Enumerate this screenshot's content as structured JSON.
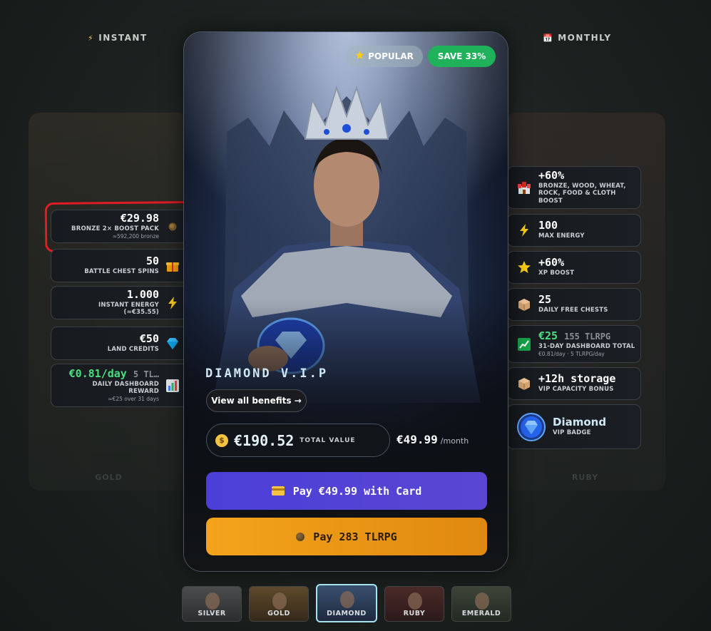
{
  "tabs": {
    "instant": {
      "icon": "⚡",
      "label": "INSTANT"
    },
    "monthly": {
      "icon": "📅",
      "label": "MONTHLY"
    }
  },
  "background_cards": {
    "left_name": "GOLD",
    "right_name": "RUBY"
  },
  "left_benefits": [
    {
      "main": "€29.98",
      "sub": "BRONZE 2× BOOST PACK",
      "note": "≈592,200 bronze",
      "icon": "bronze-coin-icon"
    },
    {
      "main": "50",
      "sub": "BATTLE CHEST SPINS",
      "icon": "gift-icon"
    },
    {
      "main": "1.000",
      "sub": "INSTANT ENERGY",
      "sub2": "(≈€35.55)",
      "icon": "lightning-icon"
    },
    {
      "main": "€50",
      "sub": "LAND CREDITS",
      "icon": "diamond-icon"
    },
    {
      "main": "€0.81/day",
      "main_suffix": "5 TL…",
      "sub": "DAILY DASHBOARD",
      "sub2": "REWARD",
      "note": "≈€25 over 31 days",
      "icon": "chart-icon"
    }
  ],
  "right_benefits": [
    {
      "main": "+60%",
      "sub": "BRONZE, WOOD, WHEAT,",
      "sub2": "ROCK, FOOD & CLOTH",
      "sub3": "BOOST",
      "icon": "castle-icon"
    },
    {
      "main": "100",
      "sub": "MAX ENERGY",
      "icon": "lightning-icon"
    },
    {
      "main": "+60%",
      "sub": "XP BOOST",
      "icon": "star-icon"
    },
    {
      "main": "25",
      "sub": "DAILY FREE CHESTS",
      "icon": "chest-icon"
    },
    {
      "main": "€25",
      "main_suffix": "155 TLRPG",
      "sub": "31-DAY DASHBOARD TOTAL",
      "note": "€0.81/day · 5 TLRPG/day",
      "icon": "trend-icon"
    },
    {
      "main": "+12h storage",
      "sub": "VIP CAPACITY BONUS",
      "icon": "box-icon"
    },
    {
      "main": "Diamond",
      "sub": "VIP BADGE",
      "icon": "diamond-badge-icon"
    }
  ],
  "main_card": {
    "popular_label": "POPULAR",
    "save_label": "SAVE 33%",
    "tier_name": "DIAMOND V.I.P",
    "benefits_button": "View all benefits →",
    "total_value_amount": "€190.52",
    "total_value_label": "TOTAL VALUE",
    "price": "€49.99",
    "price_period": "/month",
    "pay_card_label": "Pay €49.99 with Card",
    "pay_tlrpg_label": "Pay 283 TLRPG"
  },
  "tiers": [
    {
      "label": "SILVER",
      "selected": false
    },
    {
      "label": "GOLD",
      "selected": false
    },
    {
      "label": "DIAMOND",
      "selected": true
    },
    {
      "label": "RUBY",
      "selected": false
    },
    {
      "label": "EMERALD",
      "selected": false
    }
  ],
  "colors": {
    "accent_green": "#4ade80",
    "save_green": "#1fb25a",
    "card_button": "#4b3fd8",
    "tlrpg_button": "#f3a41b",
    "highlight_red": "#e01b24",
    "diamond_border": "#a8e3f2"
  }
}
